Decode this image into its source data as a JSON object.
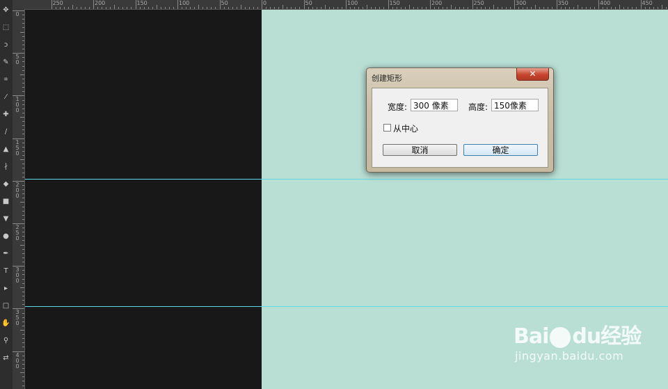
{
  "toolbar": {
    "tools": [
      {
        "name": "move-tool-icon",
        "glyph": "✥"
      },
      {
        "name": "marquee-tool-icon",
        "glyph": "⬚"
      },
      {
        "name": "lasso-tool-icon",
        "glyph": "ↄ"
      },
      {
        "name": "quick-select-tool-icon",
        "glyph": "✎"
      },
      {
        "name": "crop-tool-icon",
        "glyph": "⌗"
      },
      {
        "name": "eyedropper-tool-icon",
        "glyph": "⁄"
      },
      {
        "name": "healing-tool-icon",
        "glyph": "✚"
      },
      {
        "name": "brush-tool-icon",
        "glyph": "∕"
      },
      {
        "name": "stamp-tool-icon",
        "glyph": "▲"
      },
      {
        "name": "history-brush-tool-icon",
        "glyph": "∤"
      },
      {
        "name": "eraser-tool-icon",
        "glyph": "◆"
      },
      {
        "name": "gradient-tool-icon",
        "glyph": "■"
      },
      {
        "name": "blur-tool-icon",
        "glyph": "▼"
      },
      {
        "name": "dodge-tool-icon",
        "glyph": "●"
      },
      {
        "name": "pen-tool-icon",
        "glyph": "✒"
      },
      {
        "name": "type-tool-icon",
        "glyph": "T"
      },
      {
        "name": "path-select-tool-icon",
        "glyph": "▸"
      },
      {
        "name": "rectangle-tool-icon",
        "glyph": "□"
      },
      {
        "name": "hand-tool-icon",
        "glyph": "✋"
      },
      {
        "name": "zoom-tool-icon",
        "glyph": "⚲"
      },
      {
        "name": "swap-colors-icon",
        "glyph": "⇄"
      }
    ]
  },
  "rulers": {
    "horizontal": [
      "250",
      "200",
      "150",
      "100",
      "50",
      "0",
      "50",
      "100",
      "150",
      "200",
      "250",
      "300",
      "350",
      "400",
      "450"
    ],
    "vertical": [
      "0",
      "50",
      "100",
      "150",
      "200",
      "250",
      "300",
      "350",
      "400"
    ]
  },
  "dialog": {
    "title": "创建矩形",
    "close_glyph": "✕",
    "width_label": "宽度:",
    "width_value": "300 像素",
    "height_label": "高度:",
    "height_value": "150像素",
    "from_center_label": "从中心",
    "cancel_label": "取消",
    "ok_label": "确定"
  },
  "watermark": {
    "logo": "Bai",
    "logo_tail": "du",
    "logo_cn": "经验",
    "url": "jingyan.baidu.com"
  }
}
